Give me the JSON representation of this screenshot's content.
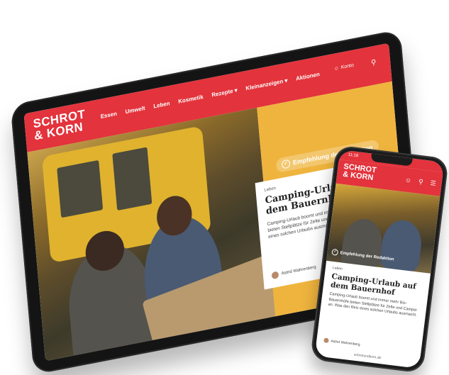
{
  "tablet": {
    "logo_line1": "SCHROT",
    "logo_line2": "& KORN",
    "menu": [
      "Essen",
      "Umwelt",
      "Leben",
      "Kosmetik",
      "Rezepte ▾",
      "Kleinanzeigen ▾",
      "Aktionen"
    ],
    "account_label": "Konto",
    "search_icon": "search-icon",
    "badge": "Empfehlung der Redaktion",
    "article": {
      "category": "Leben",
      "title": "Camping-Urlaub auf dem Bauernhof",
      "teaser": "Camping-Urlaub boomt und immer mehr Bio-Bauernhöfe bieten Stellplätze für Zelte und Camper an. Was den Reiz eines solchen Urlaubs ausmacht.",
      "author": "Astrid Wahrenberg"
    }
  },
  "phone": {
    "time": "11:18",
    "logo_line1": "SCHROT",
    "logo_line2": "& KORN",
    "badge": "Empfehlung der Redaktion",
    "article": {
      "category": "Leben",
      "title": "Camping-Urlaub auf dem Bauernhof",
      "teaser": "Camping-Urlaub boomt und immer mehr Bio-Bauernhöfe bieten Stellplätze für Zelte und Camper an. Was den Reiz eines solchen Urlaubs ausmacht.",
      "author": "Astrid Wahrenberg"
    },
    "url": "schrotundkorn.de"
  },
  "colors": {
    "brand_red": "#e3333c",
    "accent_yellow": "#efb43e"
  }
}
